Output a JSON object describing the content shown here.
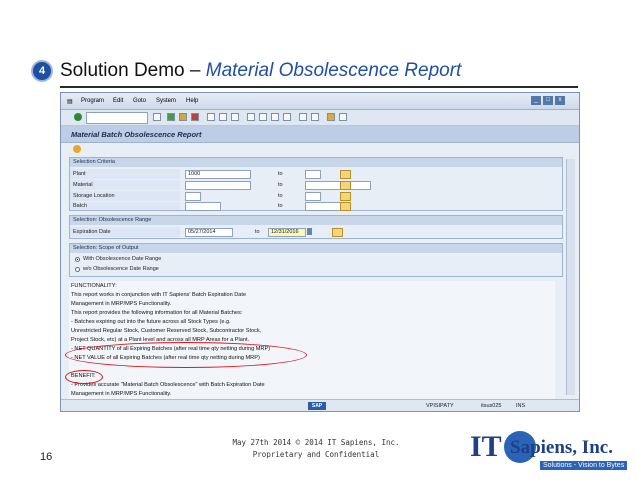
{
  "slide": {
    "badge_number": "4",
    "title_main": "Solution Demo – ",
    "title_sub": "Material Obsolescence Report",
    "page_number": "16",
    "footer_line1": "May 27th 2014   © 2014 IT Sapiens, Inc.",
    "footer_line2": "Proprietary and Confidential",
    "logo_it": "IT",
    "logo_name": "Sapiens, Inc.",
    "logo_tagline": "Solutions - Vision to Bytes"
  },
  "sap": {
    "menu": [
      "Program",
      "Edit",
      "Goto",
      "System",
      "Help"
    ],
    "window_controls": [
      "_",
      "□",
      "x"
    ],
    "title": "Material Batch Obsolescence Report",
    "selection_criteria": {
      "title": "Selection Criteria",
      "rows": [
        {
          "label": "Plant",
          "from": "1000",
          "to_label": "to",
          "to": ""
        },
        {
          "label": "Material",
          "from": "",
          "to_label": "to",
          "to": ""
        },
        {
          "label": "Storage Location",
          "from": "",
          "to_label": "to",
          "to": ""
        },
        {
          "label": "Batch",
          "from": "",
          "to_label": "to",
          "to": ""
        }
      ]
    },
    "obsolescence_range": {
      "title": "Selection: Obsolescence Range",
      "label": "Expiration Date",
      "from": "05/27/2014",
      "to_label": "to",
      "to": "12/31/2016"
    },
    "scope_of_output": {
      "title": "Selection: Scope of Output",
      "option_with": "With Obsolescence Date Range",
      "option_without": "w/o Obsolescence Date Range"
    },
    "info_lines": [
      "FUNCTIONALITY:",
      "This report works in conjunction with IT Sapiens' Batch Expiration Date",
      "Management in MRP/MPS Functionality.",
      "This report provides the following information for all Material Batches:",
      "- Batches expiring out into the future across all Stock Types (e.g.",
      "  Unrestricted Regular Stock, Customer Reserved Stock, Subcontractor Stock,",
      "  Project Stock, etc) at a Plant level and across all MRP Areas for a Plant.",
      "- NET QUANTITY of all Expiring Batches (after real time qty netting during MRP)",
      "- NET VALUE of all Expiring Batches (after real time qty netting during MRP)",
      "",
      "BENEFIT:",
      "- Provides accurate \"Material Batch Obsolescence\" with Batch Expiration Date",
      "  Management in MRP/MPS Functionality."
    ],
    "status": {
      "system": "VPISIPATY",
      "server": "itsus025",
      "mode": "INS"
    }
  }
}
